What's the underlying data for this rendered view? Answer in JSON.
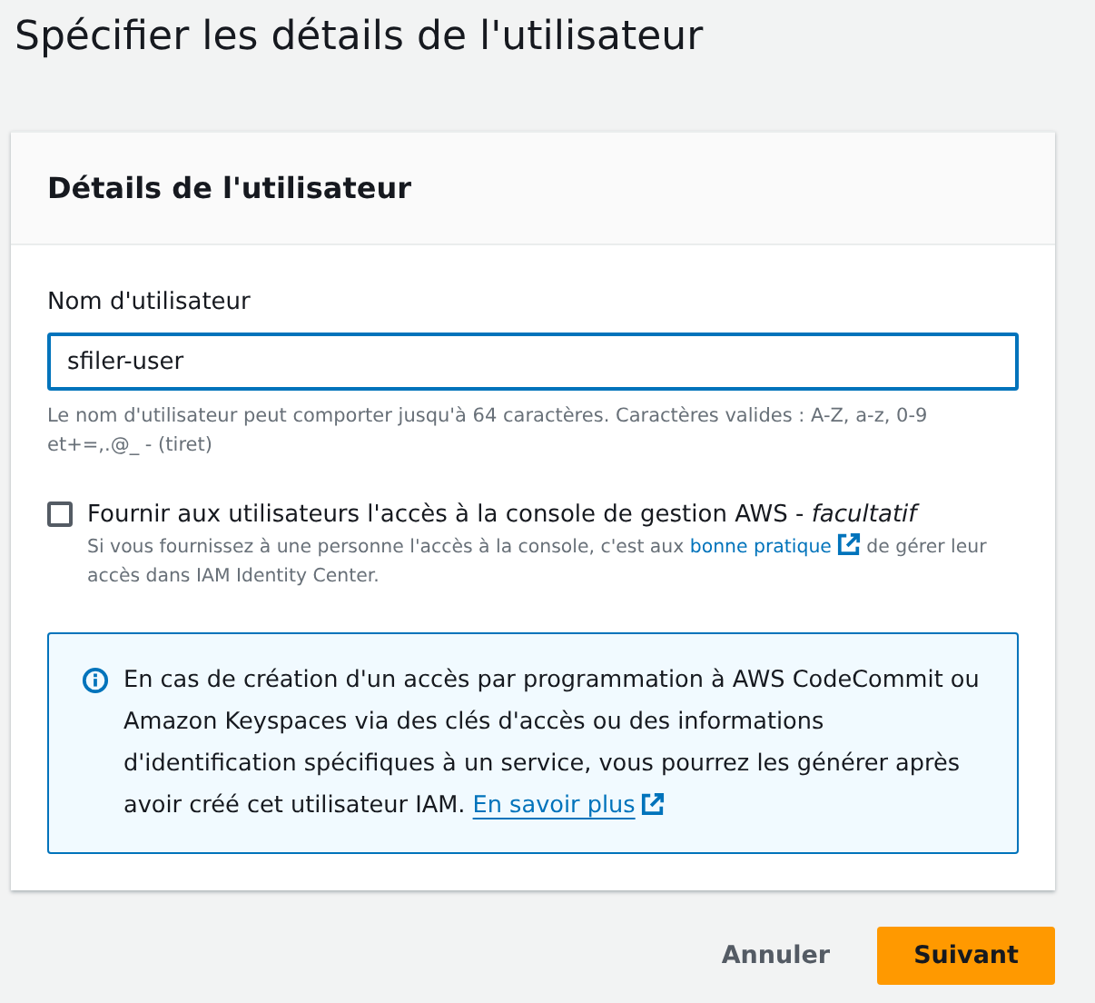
{
  "page": {
    "title": "Spécifier les détails de l'utilisateur"
  },
  "card": {
    "heading": "Détails de l'utilisateur",
    "username": {
      "label": "Nom d'utilisateur",
      "value": "sfiler-user",
      "focused": true,
      "hint": "Le nom d'utilisateur peut comporter jusqu'à 64 caractères. Caractères valides : A-Z, a-z, 0-9 et+=,.@_ - (tiret)"
    },
    "console_access": {
      "checked": false,
      "label": "Fournir aux utilisateurs l'accès à la console de gestion AWS - *facultatif*",
      "description_before": "Si vous fournissez à une personne l'accès à la console, c'est aux",
      "description_link": "bonne pratique",
      "description_after": "de gérer leur accès dans IAM Identity Center."
    },
    "info": {
      "text": "En cas de création d'un accès par programmation à AWS CodeCommit ou Amazon Keyspaces via des clés d'accès ou des informations d'identification spécifiques à un service, vous pourrez les générer après avoir créé cet utilisateur IAM.",
      "link": "En savoir plus"
    }
  },
  "buttons": [
    {
      "label": "Annuler",
      "kind": "secondary"
    },
    {
      "label": "Suivant",
      "kind": "primary"
    }
  ]
}
